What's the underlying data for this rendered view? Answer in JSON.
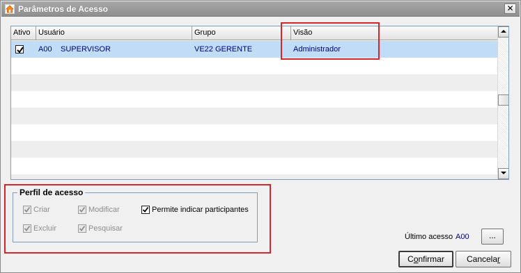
{
  "window": {
    "title": "Parâmetros de Acesso",
    "close_glyph": "✕"
  },
  "grid": {
    "columns": [
      "Ativo",
      "Usuário",
      "Grupo",
      "Visão"
    ],
    "rows": [
      {
        "ativo": true,
        "codigo": "A00",
        "usuario": "SUPERVISOR",
        "grupo": "VE22 GERENTE",
        "visao": "Administrador",
        "selected": true
      }
    ]
  },
  "perfil": {
    "legend": "Perfil de acesso",
    "options": {
      "criar": {
        "label": "Criar",
        "checked": true,
        "enabled": false
      },
      "modificar": {
        "label": "Modificar",
        "checked": true,
        "enabled": false
      },
      "permite": {
        "label": "Permite indicar participantes",
        "checked": true,
        "enabled": true
      },
      "excluir": {
        "label": "Excluir",
        "checked": true,
        "enabled": false
      },
      "pesquisar": {
        "label": "Pesquisar",
        "checked": true,
        "enabled": false
      }
    }
  },
  "footer": {
    "ultimo_acesso_label": "Último acesso",
    "ultimo_acesso_value": "A00",
    "more_button": "...",
    "confirm_pre": "C",
    "confirm_ul": "o",
    "confirm_post": "nfirmar",
    "cancel_pre": "Cancela",
    "cancel_ul": "r",
    "cancel_post": ""
  },
  "colors": {
    "highlight": "#d4262a",
    "selected_row": "#c1dcf6",
    "value_text": "#000080"
  }
}
